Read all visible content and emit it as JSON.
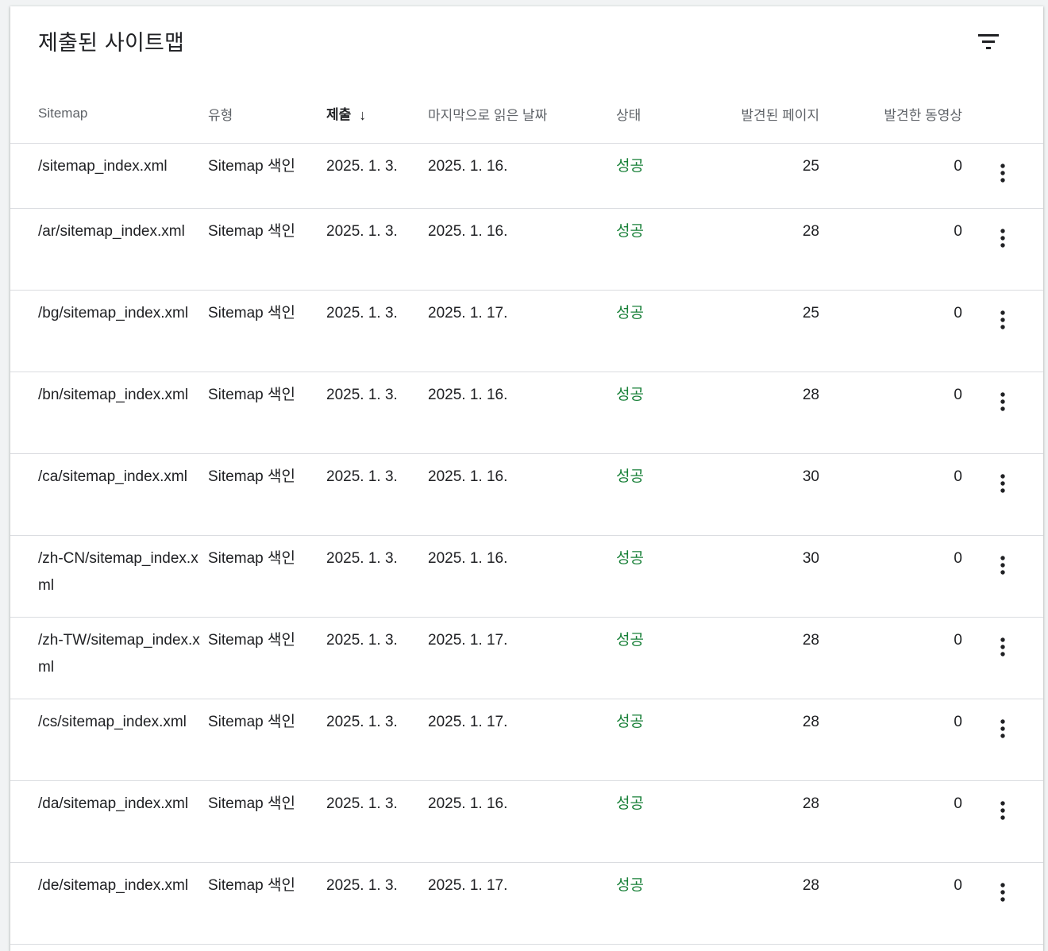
{
  "card": {
    "title": "제출된 사이트맵",
    "filter_icon": "filter-list-icon"
  },
  "table": {
    "headers": {
      "sitemap": "Sitemap",
      "type": "유형",
      "submitted": "제출",
      "sort_icon": "arrow-down-icon",
      "last_read": "마지막으로 읽은 날짜",
      "status": "상태",
      "discovered_pages": "발견된 페이지",
      "discovered_videos": "발견한 동영상"
    },
    "rows": [
      {
        "path": "/sitemap_index.xml",
        "type": "Sitemap 색인",
        "submitted": "2025. 1. 3.",
        "last_read": "2025. 1. 16.",
        "status": "성공",
        "pages": "25",
        "videos": "0"
      },
      {
        "path": "/ar/sitemap_index.xml",
        "type": "Sitemap 색인",
        "submitted": "2025. 1. 3.",
        "last_read": "2025. 1. 16.",
        "status": "성공",
        "pages": "28",
        "videos": "0"
      },
      {
        "path": "/bg/sitemap_index.xml",
        "type": "Sitemap 색인",
        "submitted": "2025. 1. 3.",
        "last_read": "2025. 1. 17.",
        "status": "성공",
        "pages": "25",
        "videos": "0"
      },
      {
        "path": "/bn/sitemap_index.xml",
        "type": "Sitemap 색인",
        "submitted": "2025. 1. 3.",
        "last_read": "2025. 1. 16.",
        "status": "성공",
        "pages": "28",
        "videos": "0"
      },
      {
        "path": "/ca/sitemap_index.xml",
        "type": "Sitemap 색인",
        "submitted": "2025. 1. 3.",
        "last_read": "2025. 1. 16.",
        "status": "성공",
        "pages": "30",
        "videos": "0"
      },
      {
        "path": "/zh-CN/sitemap_index.xml",
        "type": "Sitemap 색인",
        "submitted": "2025. 1. 3.",
        "last_read": "2025. 1. 16.",
        "status": "성공",
        "pages": "30",
        "videos": "0"
      },
      {
        "path": "/zh-TW/sitemap_index.xml",
        "type": "Sitemap 색인",
        "submitted": "2025. 1. 3.",
        "last_read": "2025. 1. 17.",
        "status": "성공",
        "pages": "28",
        "videos": "0"
      },
      {
        "path": "/cs/sitemap_index.xml",
        "type": "Sitemap 색인",
        "submitted": "2025. 1. 3.",
        "last_read": "2025. 1. 17.",
        "status": "성공",
        "pages": "28",
        "videos": "0"
      },
      {
        "path": "/da/sitemap_index.xml",
        "type": "Sitemap 색인",
        "submitted": "2025. 1. 3.",
        "last_read": "2025. 1. 16.",
        "status": "성공",
        "pages": "28",
        "videos": "0"
      },
      {
        "path": "/de/sitemap_index.xml",
        "type": "Sitemap 색인",
        "submitted": "2025. 1. 3.",
        "last_read": "2025. 1. 17.",
        "status": "성공",
        "pages": "28",
        "videos": "0"
      }
    ],
    "row_menu_icon": "more-vert-icon"
  },
  "colors": {
    "status_success": "#188038",
    "text_primary": "#202124",
    "text_secondary": "#5f6368",
    "divider": "#dadce0"
  }
}
